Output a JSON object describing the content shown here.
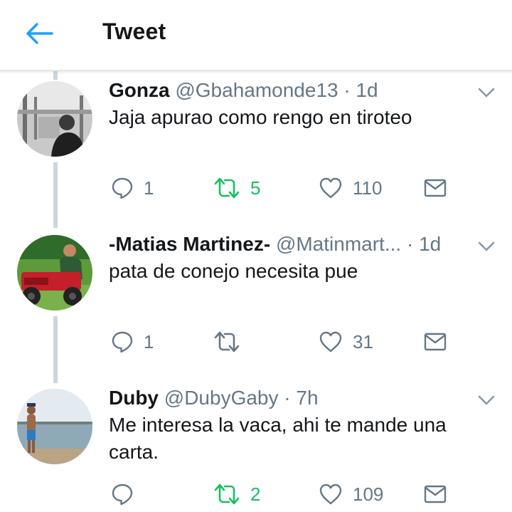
{
  "header": {
    "title": "Tweet"
  },
  "tweets": [
    {
      "name": "Gonza",
      "handle": "@Gbahamonde13",
      "dot": "·",
      "time": "1d",
      "text": "Jaja apurao como rengo en tiroteo",
      "replies": "1",
      "retweets": "5",
      "retweeted": true,
      "likes": "110"
    },
    {
      "name": "-Matias Martinez-",
      "handle": "@Matinmart...",
      "dot": "·",
      "time": "1d",
      "text": "pata de conejo necesita pue",
      "replies": "1",
      "retweets": "",
      "retweeted": false,
      "likes": "31"
    },
    {
      "name": "Duby",
      "handle": "@DubyGaby",
      "dot": "·",
      "time": "7h",
      "text": "Me interesa la vaca, ahi te mande una carta.",
      "replies": "",
      "retweets": "2",
      "retweeted": true,
      "likes": "109"
    }
  ],
  "colors": {
    "accent": "#1da1f2",
    "retweet_active": "#17bf63",
    "muted": "#657786",
    "thread_line": "#ccd6dd"
  }
}
